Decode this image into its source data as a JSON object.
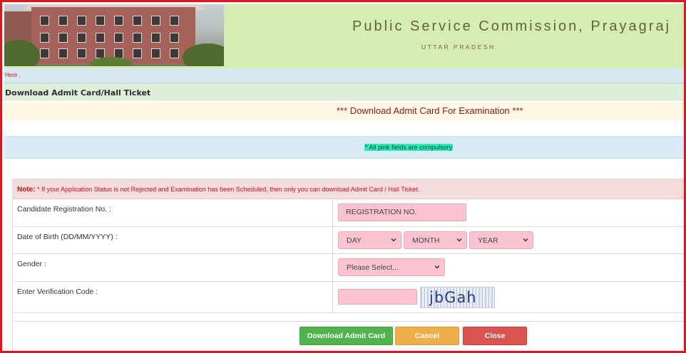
{
  "header": {
    "title": "Public Service Commission, Prayagraj",
    "subtitle": "UTTAR PRADESH"
  },
  "here_text": "Here ,",
  "breadcrumb": "Download Admit Card/Hall Ticket",
  "page_title": "*** Download Admit Card For Examination ***",
  "compulsory_note": "* All pink fields are compulsory",
  "note": {
    "label": "Note:",
    "text": "* If your Application Status is not Rejected and Examination has been Scheduled, then only you can download Admit Card / Hall Ticket."
  },
  "form": {
    "registration": {
      "label": "Candidate Registration No. :",
      "placeholder": "REGISTRATION NO.",
      "value": ""
    },
    "dob": {
      "label": "Date of Birth (DD/MM/YYYY) :",
      "day": "DAY",
      "month": "MONTH",
      "year": "YEAR"
    },
    "gender": {
      "label": "Gender :",
      "selected": "Please Select..."
    },
    "verification": {
      "label": "Enter Verification Code :",
      "value": "",
      "captcha_text": "jbGah"
    }
  },
  "buttons": {
    "download": "Download Admit Card",
    "cancel": "Cancel",
    "close": "Close"
  },
  "colors": {
    "frame_border": "#e3141b",
    "header_bg": "#d7ecb5",
    "pink_field": "#fbc4d0",
    "download_btn": "#4fb44c",
    "cancel_btn": "#efad4c",
    "close_btn": "#d9534f"
  }
}
